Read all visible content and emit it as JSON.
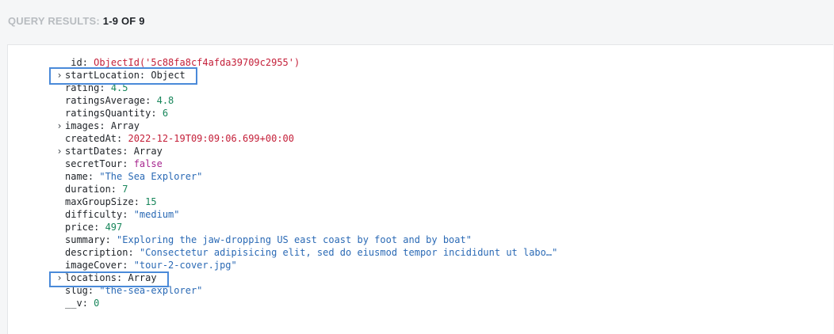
{
  "header": {
    "label": "QUERY RESULTS:",
    "count": "1-9 OF 9"
  },
  "document": {
    "fields": [
      {
        "key": "_id",
        "value": "ObjectId('5c88fa8cf4afda39709c2955')",
        "type": "oid",
        "expandable": false
      },
      {
        "key": "startLocation",
        "value": "Object",
        "type": "type",
        "expandable": true
      },
      {
        "key": "rating",
        "value": "4.5",
        "type": "num",
        "expandable": false
      },
      {
        "key": "ratingsAverage",
        "value": "4.8",
        "type": "num",
        "expandable": false
      },
      {
        "key": "ratingsQuantity",
        "value": "6",
        "type": "num",
        "expandable": false
      },
      {
        "key": "images",
        "value": "Array",
        "type": "type",
        "expandable": true
      },
      {
        "key": "createdAt",
        "value": "2022-12-19T09:09:06.699+00:00",
        "type": "date",
        "expandable": false
      },
      {
        "key": "startDates",
        "value": "Array",
        "type": "type",
        "expandable": true
      },
      {
        "key": "secretTour",
        "value": "false",
        "type": "bool",
        "expandable": false
      },
      {
        "key": "name",
        "value": "\"The Sea Explorer\"",
        "type": "str",
        "expandable": false
      },
      {
        "key": "duration",
        "value": "7",
        "type": "num",
        "expandable": false
      },
      {
        "key": "maxGroupSize",
        "value": "15",
        "type": "num",
        "expandable": false
      },
      {
        "key": "difficulty",
        "value": "\"medium\"",
        "type": "str",
        "expandable": false
      },
      {
        "key": "price",
        "value": "497",
        "type": "num",
        "expandable": false
      },
      {
        "key": "summary",
        "value": "\"Exploring the jaw-dropping US east coast by foot and by boat\"",
        "type": "str",
        "expandable": false
      },
      {
        "key": "description",
        "value": "\"Consectetur adipisicing elit, sed do eiusmod tempor incididunt ut labo…\"",
        "type": "str",
        "expandable": false
      },
      {
        "key": "imageCover",
        "value": "\"tour-2-cover.jpg\"",
        "type": "str",
        "expandable": false
      },
      {
        "key": "locations",
        "value": "Array",
        "type": "type",
        "expandable": true
      },
      {
        "key": "slug",
        "value": "\"the-sea-explorer\"",
        "type": "str",
        "expandable": false
      },
      {
        "key": "__v",
        "value": "0",
        "type": "num",
        "expandable": false
      }
    ]
  },
  "icons": {
    "expand": "chevron-right-icon",
    "expand_glyph": "›"
  },
  "colors": {
    "highlight": "#4a8ad9",
    "oid": "#c41f39",
    "number": "#18865b",
    "string": "#2b6ab5",
    "boolean": "#a7268f",
    "date": "#c41f39"
  }
}
